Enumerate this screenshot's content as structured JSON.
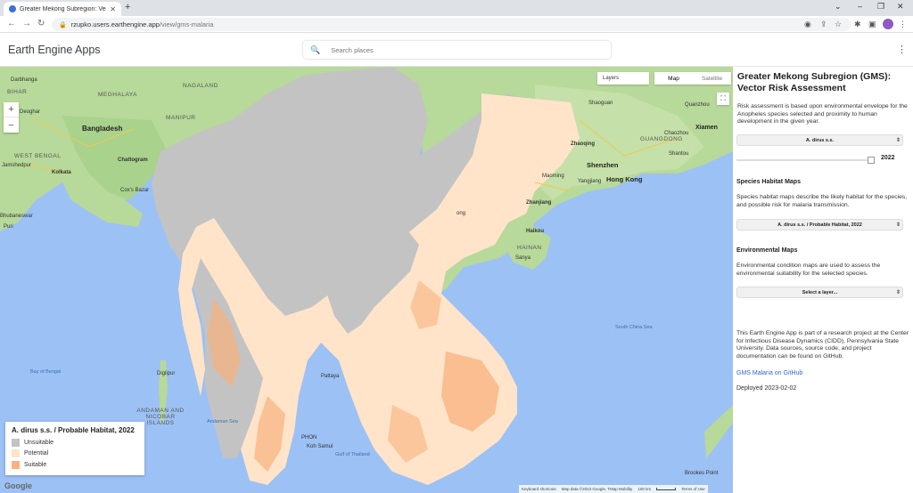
{
  "browser": {
    "tab_title": "Greater Mekong Subregion: Vec",
    "url_host": "rzupko.users.earthengine.app",
    "url_path": "/view/gms-malaria"
  },
  "header": {
    "app_name": "Earth Engine Apps",
    "search_placeholder": "Search places"
  },
  "map": {
    "layers_label": "Layers",
    "map_type": [
      "Map",
      "Satellite"
    ],
    "labels": {
      "darbhanga": "Darbhanga",
      "nagaland": "NAGALAND",
      "bihar": "BIHAR",
      "meghalaya": "MEGHALAYA",
      "manipur": "MANIPUR",
      "deoghar": "Deoghar",
      "bangladesh": "Bangladesh",
      "jamshedpur": "Jamshedpur",
      "west_bengal": "WEST BENGAL",
      "chattogram": "Chattogram",
      "kolkata": "Kolkata",
      "coxs_bazar": "Cox's Bazar",
      "bhubaneswar": "Bhubaneswar",
      "puri": "Puri",
      "bay_of_bengal": "Bay of Bengal",
      "digipur": "Diglipur",
      "andaman": "ANDAMAN AND NICOBAR ISLANDS",
      "andaman_sea": "Andaman Sea",
      "shaoguan": "Shaoguan",
      "quanzhou": "Quanzhou",
      "xiamen": "Xiamen",
      "guangdong": "GUANGDONG",
      "zhaoqing": "Zhaoqing",
      "chaozhou": "Chaozhou",
      "shantou": "Shantou",
      "shenzhen": "Shenzhen",
      "hongkong": "Hong Kong",
      "maoming": "Maoming",
      "yangjiang": "Yangjiang",
      "zhanjiang": "Zhanjiang",
      "haikou": "Haikou",
      "hainan": "HAINAN",
      "sanya": "Sanya",
      "south_china_sea": "South China Sea",
      "pattaya": "Pattaya",
      "gulf_thailand": "Gulf of Thailand",
      "koh_samui": "Koh Samui",
      "brookes_point": "Brookes Point",
      "phon": "PHON",
      "hong": "ong"
    },
    "legend": {
      "title": "A. dirus s.s. / Probable Habitat, 2022",
      "items": [
        {
          "label": "Unsuitable",
          "color": "#c3c3c3"
        },
        {
          "label": "Potential",
          "color": "#ffe4c9"
        },
        {
          "label": "Suitable",
          "color": "#f8b27e"
        }
      ]
    },
    "attribution": {
      "shortcuts": "Keyboard shortcuts",
      "data": "Map data ©2023 Google, TMap Mobility",
      "scale": "100 km",
      "terms": "Terms of Use"
    },
    "google_logo": "Google"
  },
  "panel": {
    "title": "Greater Mekong Subregion (GMS): Vector Risk Assessment",
    "intro": "Risk assessment is based upon environmental envelope for the Anopheles species selected and proximity to human development in the given year.",
    "species_select": "A. dirus s.s.",
    "year": "2022",
    "year_slider_level": 1.0,
    "habitat_heading": "Species Habitat Maps",
    "habitat_text": "Species habitat maps describe the likely habitat for the species, and possible risk for malaria transmission.",
    "habitat_select": "A. dirus s.s. / Probable Habitat, 2022",
    "env_heading": "Environmental Maps",
    "env_text": "Environmental condition maps are used to assess the environmental suitability for the selected species.",
    "env_select": "Select a layer...",
    "about_text": "This Earth Engine App is part of a research project at the Center for Infectious Disease Dynamics (CIDD), Pennsylvania State University. Data sources, source code, and project documentation can be found on GitHub.",
    "github_link": "GMS Malaria on GitHub",
    "deployed": "Deployed 2023-02-02"
  }
}
